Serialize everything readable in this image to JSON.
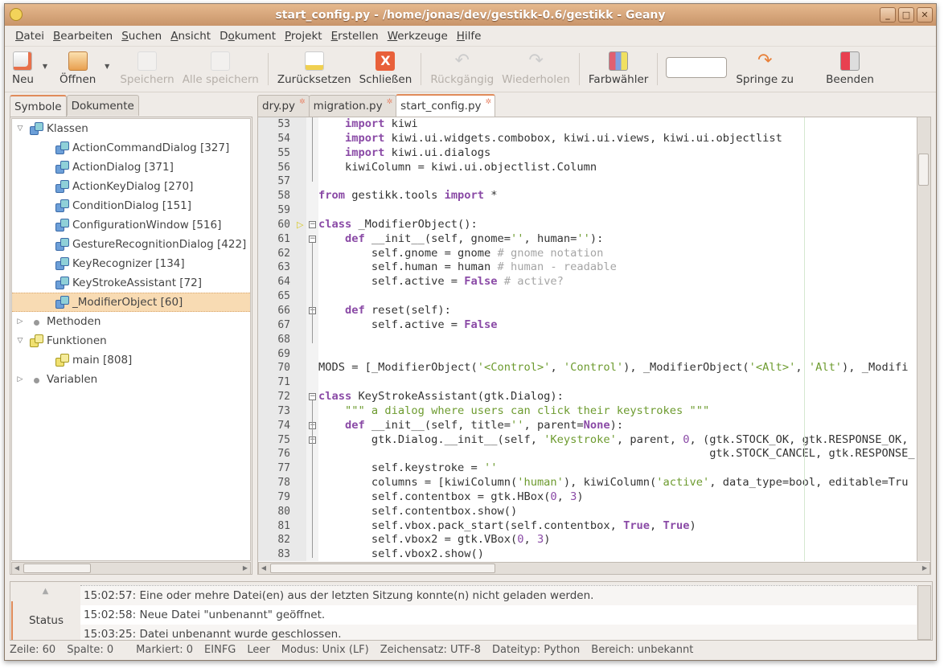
{
  "window": {
    "title": "start_config.py - /home/jonas/dev/gestikk-0.6/gestikk - Geany",
    "controls": [
      "_",
      "□",
      "✕"
    ]
  },
  "menu": [
    {
      "u": "D",
      "rest": "atei"
    },
    {
      "u": "B",
      "rest": "earbeiten"
    },
    {
      "u": "S",
      "rest": "uchen"
    },
    {
      "u": "A",
      "rest": "nsicht"
    },
    {
      "pre": "D",
      "u": "o",
      "rest": "kument"
    },
    {
      "u": "P",
      "rest": "rojekt"
    },
    {
      "u": "E",
      "rest": "rstellen"
    },
    {
      "u": "W",
      "rest": "erkzeuge"
    },
    {
      "u": "H",
      "rest": "ilfe"
    }
  ],
  "toolbar": {
    "new": "Neu",
    "open": "Öffnen",
    "save": "Speichern",
    "save_all": "Alle speichern",
    "revert": "Zurücksetzen",
    "close": "Schließen",
    "undo": "Rückgängig",
    "redo": "Wiederholen",
    "color": "Farbwähler",
    "jump_value": "",
    "jump": "Springe zu",
    "quit": "Beenden"
  },
  "sidebar": {
    "tabs": [
      "Symbole",
      "Dokumente"
    ],
    "tree": [
      {
        "label": "Klassen",
        "level": 0,
        "expander": "open",
        "icon": "class"
      },
      {
        "label": "ActionCommandDialog [327]",
        "level": 1,
        "icon": "class"
      },
      {
        "label": "ActionDialog [371]",
        "level": 1,
        "icon": "class"
      },
      {
        "label": "ActionKeyDialog [270]",
        "level": 1,
        "icon": "class"
      },
      {
        "label": "ConditionDialog [151]",
        "level": 1,
        "icon": "class"
      },
      {
        "label": "ConfigurationWindow [516]",
        "level": 1,
        "icon": "class"
      },
      {
        "label": "GestureRecognitionDialog [422]",
        "level": 1,
        "icon": "class"
      },
      {
        "label": "KeyRecognizer [134]",
        "level": 1,
        "icon": "class"
      },
      {
        "label": "KeyStrokeAssistant [72]",
        "level": 1,
        "icon": "class"
      },
      {
        "label": "_ModifierObject [60]",
        "level": 1,
        "icon": "class",
        "selected": true
      },
      {
        "label": "Methoden",
        "level": 0,
        "expander": "closed",
        "icon": "method"
      },
      {
        "label": "Funktionen",
        "level": 0,
        "expander": "open",
        "icon": "function"
      },
      {
        "label": "main [808]",
        "level": 1,
        "icon": "function"
      },
      {
        "label": "Variablen",
        "level": 0,
        "expander": "closed",
        "icon": "variable"
      }
    ]
  },
  "editor": {
    "tabs": [
      {
        "label": "dry.py"
      },
      {
        "label": "migration.py"
      },
      {
        "label": "start_config.py",
        "active": true
      }
    ],
    "first_line": 53,
    "current_line": 60,
    "fold_lines": [
      60,
      61,
      66,
      72,
      74,
      75
    ],
    "lines": [
      "    import kiwi",
      "    import kiwi.ui.widgets.combobox, kiwi.ui.views, kiwi.ui.objectlist",
      "    import kiwi.ui.dialogs",
      "    kiwiColumn = kiwi.ui.objectlist.Column",
      "",
      "from gestikk.tools import *",
      "",
      "class _ModifierObject():",
      "    def __init__(self, gnome='', human=''):",
      "        self.gnome = gnome # gnome notation",
      "        self.human = human # human - readable",
      "        self.active = False # active?",
      "",
      "    def reset(self):",
      "        self.active = False",
      "",
      "",
      "MODS = [_ModifierObject('<Control>', 'Control'), _ModifierObject('<Alt>', 'Alt'), _Modifi",
      "",
      "class KeyStrokeAssistant(gtk.Dialog):",
      "    \"\"\" a dialog where users can click their keystrokes \"\"\"",
      "    def __init__(self, title='', parent=None):",
      "        gtk.Dialog.__init__(self, 'Keystroke', parent, 0, (gtk.STOCK_OK, gtk.RESPONSE_OK,",
      "                                                           gtk.STOCK_CANCEL, gtk.RESPONSE_",
      "        self.keystroke = ''",
      "        columns = [kiwiColumn('human'), kiwiColumn('active', data_type=bool, editable=Tru",
      "        self.contentbox = gtk.HBox(0, 3)",
      "        self.contentbox.show()",
      "        self.vbox.pack_start(self.contentbox, True, True)",
      "        self.vbox2 = gtk.VBox(0, 3)",
      "        self.vbox2.show()"
    ]
  },
  "messages": {
    "tab": "Status",
    "items": [
      "15:02:57: Eine oder mehre Datei(en) aus der letzten Sitzung konnte(n) nicht geladen werden.",
      "15:02:58: Neue Datei \"unbenannt\" geöffnet.",
      "15:03:25: Datei unbenannt wurde geschlossen."
    ]
  },
  "statusbar": [
    "Zeile: 60",
    "Spalte: 0",
    "Markiert: 0",
    "EINFG",
    "Leer",
    "Modus: Unix (LF)",
    "Zeichensatz: UTF-8",
    "Dateityp: Python",
    "Bereich: unbekannt"
  ],
  "colors": {
    "accent": "#e08b5a",
    "titlebar": "#d6a57c",
    "selection": "#f8dbb3",
    "keyword": "#8a4aa6",
    "string": "#6d9b2f",
    "comment": "#a5a5a5"
  }
}
